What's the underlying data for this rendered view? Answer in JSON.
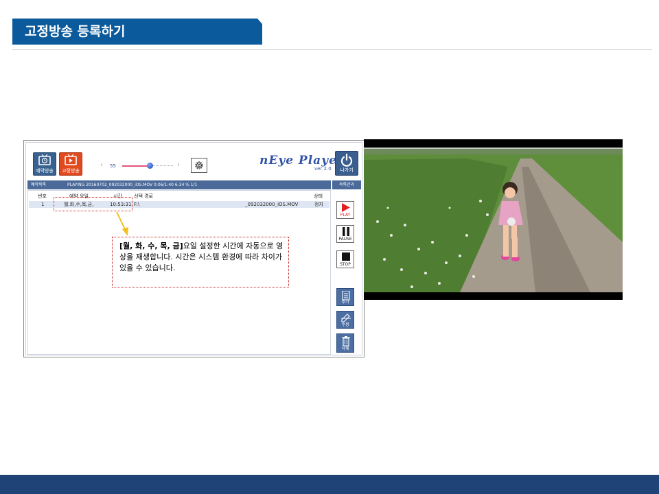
{
  "slide": {
    "title": "고정방송 등록하기"
  },
  "player": {
    "reserve_button_label": "예약방송",
    "fixed_button_label": "고정방송",
    "volume_value": "55",
    "volume_level": 0.55,
    "logo_text": "nEye Player",
    "logo_version": "ver 2.0",
    "exit_button_label": "나가기",
    "list_header_label": "예약목록",
    "playing_status": "PLAYING 20160702_092032000_iOS.MOV 0:06/1:40 6.34 % 1/1",
    "side_header_label": "목록관리",
    "columns": [
      "번호",
      "예약 요일",
      "시간",
      "선택 경로",
      "상태"
    ],
    "rows": [
      {
        "number": "1",
        "days": "월,화,수,목,금,",
        "time": "10:53:31",
        "path_prefix": "F:\\",
        "path_file": "_092032000_iOS.MOV",
        "status": "정지"
      }
    ],
    "controls": {
      "play": "PLAY",
      "pause": "PAUSE",
      "stop": "STOP"
    },
    "list_buttons": {
      "add": "추가",
      "edit": "수정",
      "delete": "삭제"
    }
  },
  "callout": {
    "bold_part": "[월, 화, 수, 목, 금]",
    "text_part": "요일 설정한 시간에 자동으로 영상을 재생합니다. 시간은 시스템 환경에 따라 차이가 있을 수 있습니다."
  },
  "colors": {
    "title_banner": "#0b5a9c",
    "bottom_bar": "#1f4377",
    "callout_border": "#c01818",
    "play_red": "#e02222"
  }
}
